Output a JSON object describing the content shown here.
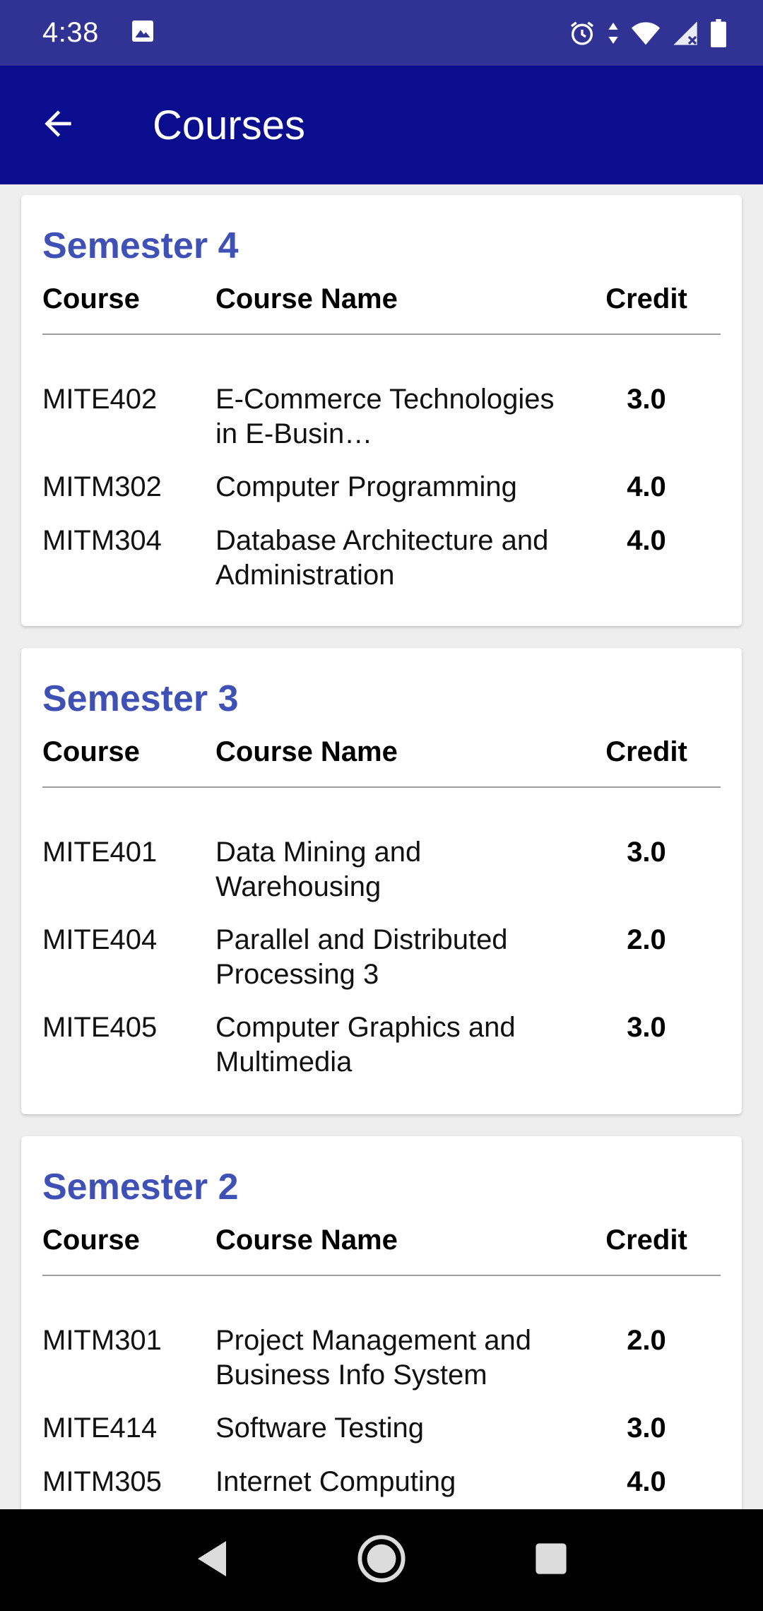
{
  "status_bar": {
    "time": "4:38",
    "icons": [
      "image-icon",
      "alarm-icon",
      "data-arrows-icon",
      "wifi-icon",
      "signal-icon",
      "battery-icon"
    ]
  },
  "app_bar": {
    "title": "Courses",
    "back_icon": "arrow-back-icon"
  },
  "table_headers": {
    "code": "Course",
    "name": "Course Name",
    "credit": "Credit"
  },
  "semesters": [
    {
      "title": "Semester 4",
      "courses": [
        {
          "code": "MITE402",
          "name": "E-Commerce Technologies in E-Busin…",
          "credit": "3.0"
        },
        {
          "code": "MITM302",
          "name": "Computer Programming",
          "credit": "4.0"
        },
        {
          "code": "MITM304",
          "name": "Database Architecture and Administration",
          "credit": "4.0"
        }
      ]
    },
    {
      "title": "Semester 3",
      "courses": [
        {
          "code": "MITE401",
          "name": "Data Mining and Warehousing",
          "credit": "3.0"
        },
        {
          "code": "MITE404",
          "name": "Parallel and Distributed Processing 3",
          "credit": "2.0"
        },
        {
          "code": "MITE405",
          "name": "Computer Graphics and Multimedia",
          "credit": "3.0"
        }
      ]
    },
    {
      "title": "Semester 2",
      "courses": [
        {
          "code": "MITM301",
          "name": "Project Management and Business Info System",
          "credit": "2.0"
        },
        {
          "code": "MITE414",
          "name": "Software Testing",
          "credit": "3.0"
        },
        {
          "code": "MITM305",
          "name": "Internet Computing",
          "credit": "4.0"
        }
      ]
    }
  ],
  "nav_bar": {
    "icons": [
      "nav-back-icon",
      "nav-home-icon",
      "nav-recents-icon"
    ]
  },
  "colors": {
    "status_bar": "#303393",
    "app_bar": "#0a0d8e",
    "semester_title": "#3f51b5"
  }
}
